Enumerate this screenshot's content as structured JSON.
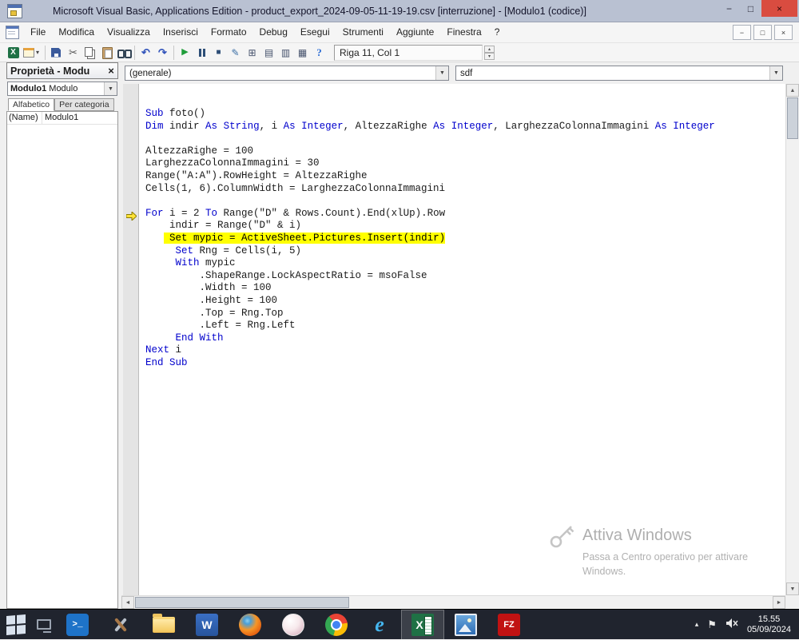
{
  "window": {
    "title": "Microsoft Visual Basic, Applications Edition - product_export_2024-09-05-11-19-19.csv [interruzione] - [Modulo1 (codice)]",
    "minimize_glyph": "−",
    "maximize_glyph": "□",
    "close_glyph": "×"
  },
  "colors": {
    "titlebar": "#b9c1d2",
    "close_button": "#d94c40",
    "keyword": "#0000cc",
    "exec_highlight": "#ffff00",
    "taskbar": "#20242e",
    "excel_green": "#1f7145",
    "filezilla_red": "#c11212",
    "word_blue": "#27549c",
    "powershell_blue": "#1e73c8"
  },
  "glyphs": {
    "dropdown": "▼",
    "caret": "▴",
    "flag": "⚑",
    "spin_up": "▴",
    "spin_down": "▾",
    "scroll_up": "▲",
    "scroll_down": "▼",
    "scroll_left": "◄",
    "scroll_right": "►"
  },
  "menu": {
    "items": [
      "File",
      "Modifica",
      "Visualizza",
      "Inserisci",
      "Formato",
      "Debug",
      "Esegui",
      "Strumenti",
      "Aggiunte",
      "Finestra",
      "?"
    ],
    "child_minimize": "−",
    "child_restore": "□",
    "child_close": "×"
  },
  "toolbar": {
    "position_indicator": "Riga 11, Col 1",
    "icons": [
      {
        "name": "view-excel",
        "glyph": "X"
      },
      {
        "name": "insert-userform"
      },
      {
        "sep": true
      },
      {
        "name": "save"
      },
      {
        "name": "cut",
        "glyph": "✂"
      },
      {
        "name": "copy"
      },
      {
        "name": "paste"
      },
      {
        "name": "find"
      },
      {
        "sep": true
      },
      {
        "name": "undo",
        "glyph": "↶"
      },
      {
        "name": "redo",
        "glyph": "↷"
      },
      {
        "sep": true
      },
      {
        "name": "run",
        "glyph": "▶"
      },
      {
        "name": "break"
      },
      {
        "name": "reset",
        "glyph": "■"
      },
      {
        "name": "design-mode",
        "glyph": "✎"
      },
      {
        "name": "project-explorer",
        "glyph": "⊞"
      },
      {
        "name": "properties-window",
        "glyph": "▤"
      },
      {
        "name": "object-browser",
        "glyph": "▥"
      },
      {
        "name": "toolbox",
        "glyph": "▦"
      },
      {
        "name": "help",
        "glyph": "?"
      }
    ]
  },
  "properties_panel": {
    "title": "Proprietà - Modu",
    "close_glyph": "×",
    "object_name": "Modulo1",
    "object_type": "Modulo",
    "tabs": [
      "Alfabetico",
      "Per categoria"
    ],
    "rows": [
      {
        "name": "(Name)",
        "value": "Modulo1"
      }
    ]
  },
  "code_window": {
    "object_dropdown": "(generale)",
    "procedure_dropdown": "sdf",
    "current_line": 11,
    "lines": [
      [
        [
          "Sub",
          "k"
        ],
        [
          " foto()",
          "p"
        ]
      ],
      [
        [
          "Dim",
          "k"
        ],
        [
          " indir ",
          "p"
        ],
        [
          "As",
          "k"
        ],
        [
          " ",
          "p"
        ],
        [
          "String",
          "k"
        ],
        [
          ", i ",
          "p"
        ],
        [
          "As",
          "k"
        ],
        [
          " ",
          "p"
        ],
        [
          "Integer",
          "k"
        ],
        [
          ", AltezzaRighe ",
          "p"
        ],
        [
          "As",
          "k"
        ],
        [
          " ",
          "p"
        ],
        [
          "Integer",
          "k"
        ],
        [
          ", LarghezzaColonnaImmagini ",
          "p"
        ],
        [
          "As",
          "k"
        ],
        [
          " ",
          "p"
        ],
        [
          "Integer",
          "k"
        ]
      ],
      [],
      [
        [
          "AltezzaRighe = 100",
          "p"
        ]
      ],
      [
        [
          "LarghezzaColonnaImmagini = 30",
          "p"
        ]
      ],
      [
        [
          "Range(\"A:A\").RowHeight = AltezzaRighe",
          "p"
        ]
      ],
      [
        [
          "Cells(1, 6).ColumnWidth = LarghezzaColonnaImmagini",
          "p"
        ]
      ],
      [],
      [
        [
          "For",
          "k"
        ],
        [
          " i = 2 ",
          "p"
        ],
        [
          "To",
          "k"
        ],
        [
          " Range(\"D\" & Rows.Count).End(xlUp).Row",
          "p"
        ]
      ],
      [
        [
          "    indir = Range(\"D\" & i)",
          "p"
        ]
      ],
      [
        [
          "   ",
          "p"
        ],
        [
          " Set mypic = ActiveSheet.Pictures.Insert(indir)",
          "h"
        ]
      ],
      [
        [
          "     ",
          "p"
        ],
        [
          "Set",
          "k"
        ],
        [
          " Rng = Cells(i, 5)",
          "p"
        ]
      ],
      [
        [
          "     ",
          "p"
        ],
        [
          "With",
          "k"
        ],
        [
          " mypic",
          "p"
        ]
      ],
      [
        [
          "         .ShapeRange.LockAspectRatio = msoFalse",
          "p"
        ]
      ],
      [
        [
          "         .Width = 100",
          "p"
        ]
      ],
      [
        [
          "         .Height = 100",
          "p"
        ]
      ],
      [
        [
          "         .Top = Rng.Top",
          "p"
        ]
      ],
      [
        [
          "         .Left = Rng.Left",
          "p"
        ]
      ],
      [
        [
          "     ",
          "p"
        ],
        [
          "End With",
          "k"
        ]
      ],
      [
        [
          "Next",
          "k"
        ],
        [
          " i",
          "p"
        ]
      ],
      [
        [
          "End Sub",
          "k"
        ]
      ]
    ]
  },
  "watermark": {
    "title": "Attiva Windows",
    "line1": "Passa a Centro operativo per attivare",
    "line2": "Windows."
  },
  "taskbar": {
    "icons": [
      {
        "name": "start"
      },
      {
        "name": "desktop"
      },
      {
        "name": "powershell",
        "glyph": ">_"
      },
      {
        "name": "tools"
      },
      {
        "name": "file-explorer"
      },
      {
        "name": "word",
        "glyph": "W"
      },
      {
        "name": "firefox"
      },
      {
        "name": "media-player"
      },
      {
        "name": "chrome"
      },
      {
        "name": "internet-explorer",
        "glyph": "e"
      },
      {
        "name": "excel",
        "glyph": "X",
        "active": true
      },
      {
        "name": "photo-viewer"
      },
      {
        "name": "filezilla",
        "glyph": "FZ"
      }
    ],
    "clock": {
      "time": "15.55",
      "date": "05/09/2024"
    }
  }
}
